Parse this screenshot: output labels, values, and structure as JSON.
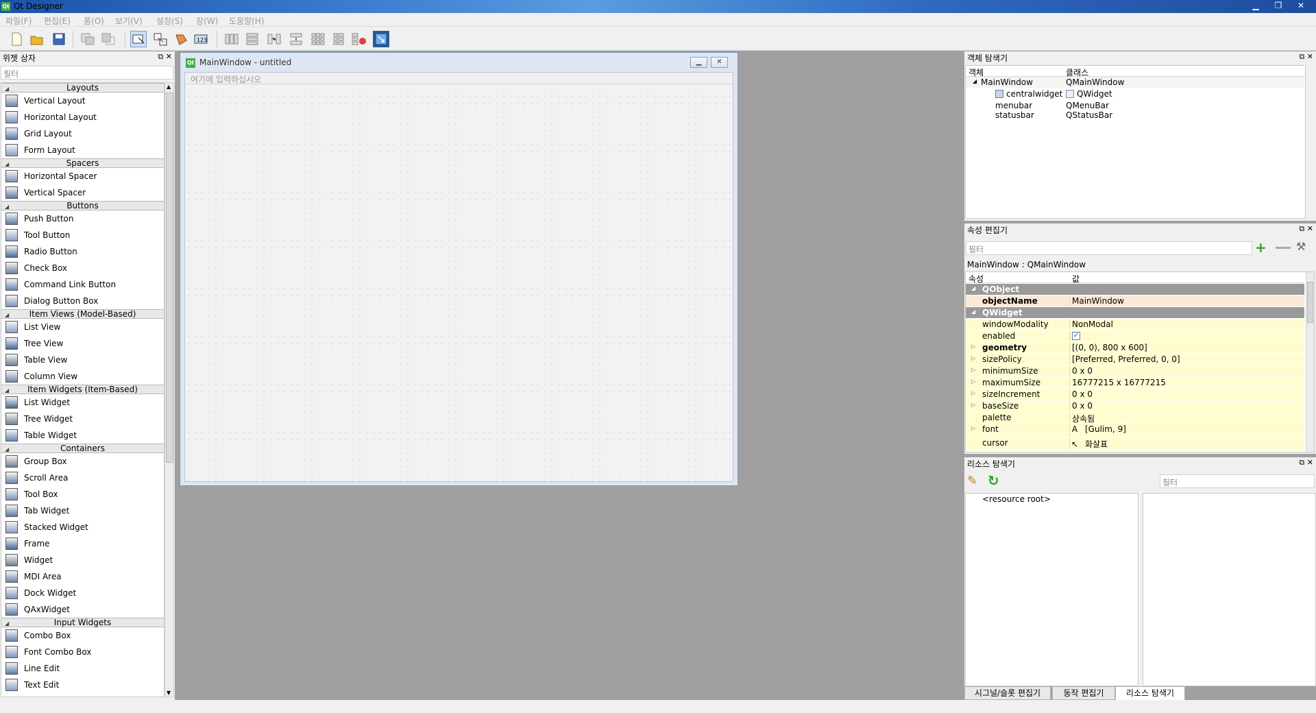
{
  "app": {
    "title": "Qt Designer"
  },
  "window_controls": {
    "minimize": "▁",
    "restore": "❐",
    "close": "✕"
  },
  "menu": [
    "파일(F)",
    "편집(E)",
    "폼(O)",
    "보기(V)",
    "설정(S)",
    "창(W)",
    "도움말(H)"
  ],
  "toolbar": {
    "icons": [
      "new-icon",
      "open-icon",
      "save-icon",
      "bring-front-icon",
      "send-back-icon",
      "edit-widgets-icon",
      "edit-signals-icon",
      "edit-buddies-icon",
      "edit-tab-order-icon",
      "layout-horizontal-icon",
      "layout-vertical-icon",
      "layout-h-splitter-icon",
      "layout-v-splitter-icon",
      "layout-grid-icon",
      "layout-form-icon",
      "break-layout-icon",
      "adjust-size-icon"
    ]
  },
  "widget_box": {
    "title": "위젯 상자",
    "filter_placeholder": "필터",
    "categories": [
      {
        "name": "Layouts",
        "items": [
          "Vertical Layout",
          "Horizontal Layout",
          "Grid Layout",
          "Form Layout"
        ]
      },
      {
        "name": "Spacers",
        "items": [
          "Horizontal Spacer",
          "Vertical Spacer"
        ]
      },
      {
        "name": "Buttons",
        "items": [
          "Push Button",
          "Tool Button",
          "Radio Button",
          "Check Box",
          "Command Link Button",
          "Dialog Button Box"
        ]
      },
      {
        "name": "Item Views (Model-Based)",
        "items": [
          "List View",
          "Tree View",
          "Table View",
          "Column View"
        ]
      },
      {
        "name": "Item Widgets (Item-Based)",
        "items": [
          "List Widget",
          "Tree Widget",
          "Table Widget"
        ]
      },
      {
        "name": "Containers",
        "items": [
          "Group Box",
          "Scroll Area",
          "Tool Box",
          "Tab Widget",
          "Stacked Widget",
          "Frame",
          "Widget",
          "MDI Area",
          "Dock Widget",
          "QAxWidget"
        ]
      },
      {
        "name": "Input Widgets",
        "items": [
          "Combo Box",
          "Font Combo Box",
          "Line Edit",
          "Text Edit"
        ]
      }
    ]
  },
  "form_window": {
    "title": "MainWindow - untitled",
    "menubar_placeholder": "여기에 입력하십시오"
  },
  "object_inspector": {
    "title": "객체 탐색기",
    "col_object": "객체",
    "col_class": "클래스",
    "rows": [
      {
        "object": "MainWindow",
        "class": "QMainWindow"
      },
      {
        "object": "centralwidget",
        "class": "QWidget"
      },
      {
        "object": "menubar",
        "class": "QMenuBar"
      },
      {
        "object": "statusbar",
        "class": "QStatusBar"
      }
    ]
  },
  "property_editor": {
    "title": "속성 편집기",
    "filter_placeholder": "필터",
    "context": "MainWindow : QMainWindow",
    "col_property": "속성",
    "col_value": "값",
    "rows": [
      {
        "type": "group",
        "name": "QObject"
      },
      {
        "type": "prop",
        "name": "objectName",
        "value": "MainWindow",
        "bold": true,
        "style": "pk"
      },
      {
        "type": "group",
        "name": "QWidget"
      },
      {
        "type": "prop",
        "name": "windowModality",
        "value": "NonModal",
        "style": "yel"
      },
      {
        "type": "prop",
        "name": "enabled",
        "value": "✓",
        "style": "yel",
        "checkbox": true
      },
      {
        "type": "prop",
        "name": "geometry",
        "value": "[(0, 0), 800 x 600]",
        "bold": true,
        "expand": true,
        "style": "yel"
      },
      {
        "type": "prop",
        "name": "sizePolicy",
        "value": "[Preferred, Preferred, 0, 0]",
        "expand": true,
        "style": "yel"
      },
      {
        "type": "prop",
        "name": "minimumSize",
        "value": "0 x 0",
        "expand": true,
        "style": "yel"
      },
      {
        "type": "prop",
        "name": "maximumSize",
        "value": "16777215 x 16777215",
        "expand": true,
        "style": "yel"
      },
      {
        "type": "prop",
        "name": "sizeIncrement",
        "value": "0 x 0",
        "expand": true,
        "style": "yel"
      },
      {
        "type": "prop",
        "name": "baseSize",
        "value": "0 x 0",
        "expand": true,
        "style": "yel"
      },
      {
        "type": "prop",
        "name": "palette",
        "value": "상속됨",
        "style": "yel"
      },
      {
        "type": "prop",
        "name": "font",
        "value": "[Gulim, 9]",
        "expand": true,
        "style": "yel",
        "icon": "A"
      },
      {
        "type": "prop",
        "name": "cursor",
        "value": "화살표",
        "style": "yel",
        "icon": "↖"
      }
    ]
  },
  "resource_browser": {
    "title": "리소스 탐색기",
    "filter_placeholder": "필터",
    "root": "<resource root>"
  },
  "bottom_tabs": [
    "시그널/슬롯 편집기",
    "동작 편집기",
    "리소스 탐색기"
  ],
  "colors": {
    "accent": "#3a78cc",
    "group": "#9a9a9a",
    "prop_yellow": "#fffdd0",
    "prop_pink": "#fbe8d6"
  }
}
